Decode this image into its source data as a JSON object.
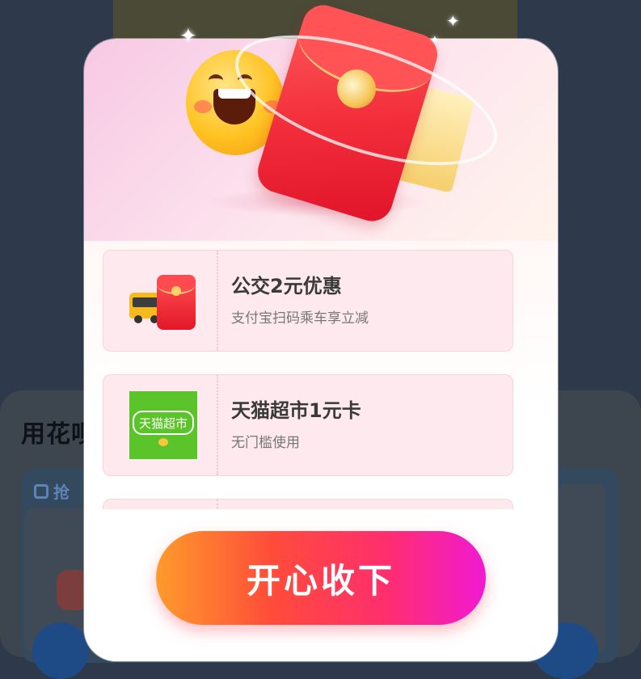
{
  "background": {
    "section_title": "用花呗",
    "card_tab": "抢"
  },
  "coupons": [
    {
      "title": "公交2元优惠",
      "subtitle": "支付宝扫码乘车享立减",
      "icon": "bus-red-packet-icon"
    },
    {
      "title": "天猫超市1元卡",
      "subtitle": "无门槛使用",
      "icon": "tmall-supermarket-icon",
      "icon_text": "天猫超市"
    }
  ],
  "cta": {
    "label": "开心收下"
  },
  "colors": {
    "cta_gradient": [
      "#ff9b2b",
      "#ff4c3a",
      "#ff2e6e",
      "#f01ad2"
    ],
    "coupon_bg": "#fde9ee",
    "tmall_green": "#5bc42b"
  }
}
